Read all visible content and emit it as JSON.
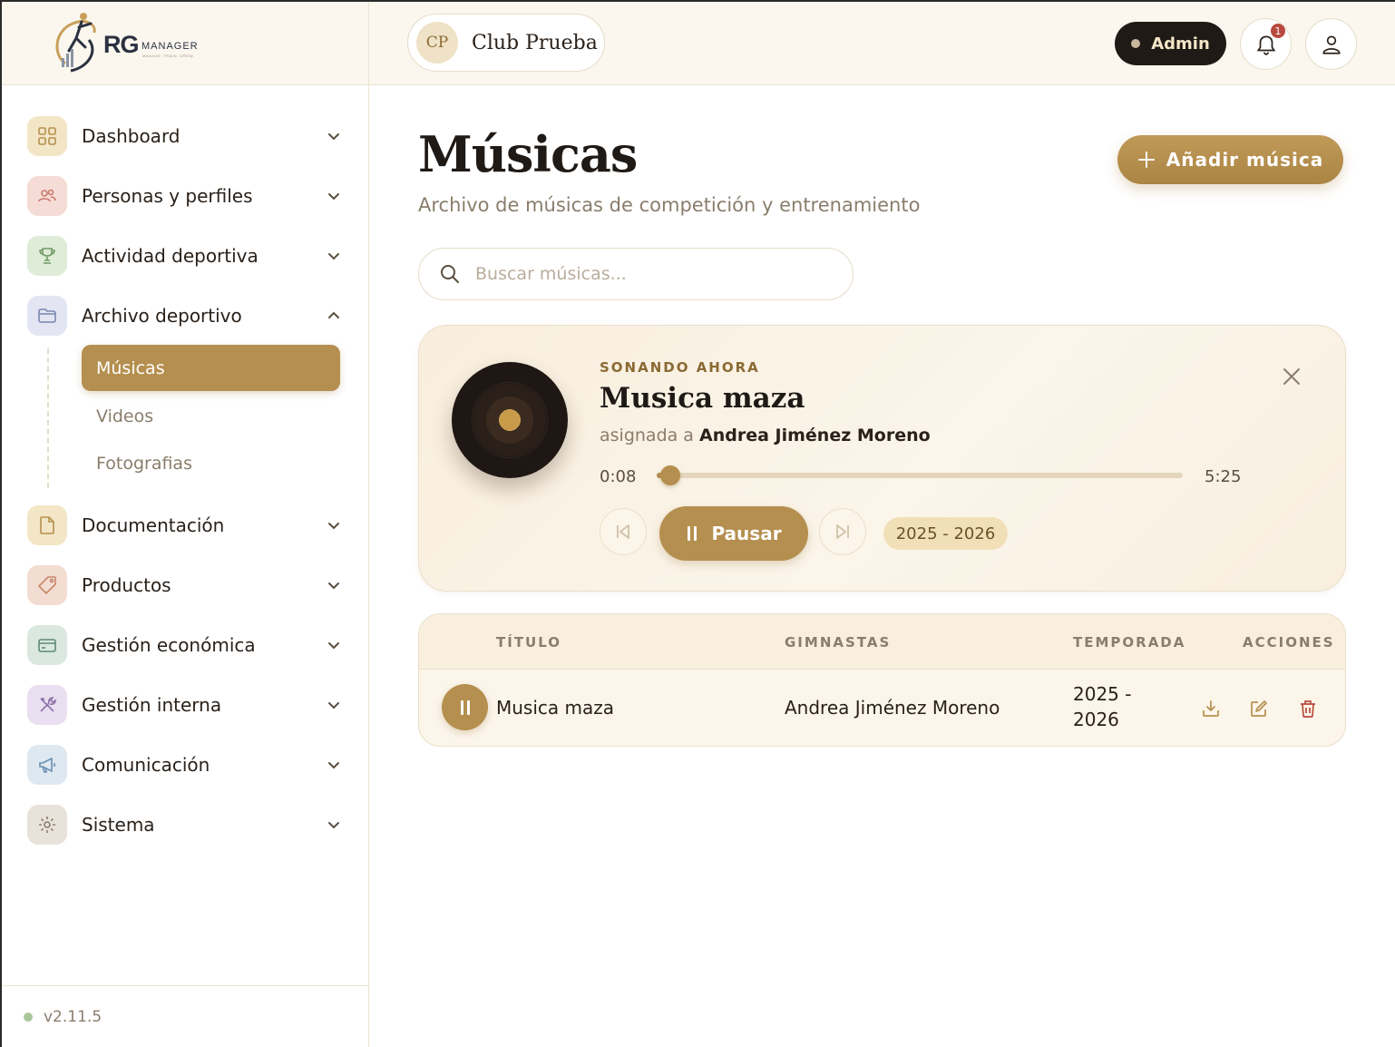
{
  "brand": {
    "logo_text": "RG",
    "logo_sub": "MANAGER",
    "logo_tagline": "MANAGE. TRAIN. GROW."
  },
  "sidebar": {
    "items": [
      {
        "label": "Dashboard",
        "icon": "grid-icon",
        "color": "#f3e6c6"
      },
      {
        "label": "Personas y perfiles",
        "icon": "users-icon",
        "color": "#f6dcd6"
      },
      {
        "label": "Actividad deportiva",
        "icon": "trophy-icon",
        "color": "#dfecd8"
      },
      {
        "label": "Archivo deportivo",
        "icon": "folder-icon",
        "color": "#e3e6f2",
        "expanded": true,
        "children": [
          {
            "label": "Músicas",
            "active": true
          },
          {
            "label": "Videos"
          },
          {
            "label": "Fotografias"
          }
        ]
      },
      {
        "label": "Documentación",
        "icon": "file-icon",
        "color": "#f3e6c6"
      },
      {
        "label": "Productos",
        "icon": "tag-icon",
        "color": "#f3ddd2"
      },
      {
        "label": "Gestión económica",
        "icon": "card-icon",
        "color": "#dae8e0"
      },
      {
        "label": "Gestión interna",
        "icon": "tools-icon",
        "color": "#eadff0"
      },
      {
        "label": "Comunicación",
        "icon": "megaphone-icon",
        "color": "#dde8f1"
      },
      {
        "label": "Sistema",
        "icon": "gear-icon",
        "color": "#e8e3da"
      }
    ],
    "version": "v2.11.5"
  },
  "header": {
    "club_initials": "CP",
    "club_name": "Club Prueba",
    "role": "Admin",
    "notifications": "1"
  },
  "page": {
    "title": "Músicas",
    "subtitle": "Archivo de músicas de competición y entrenamiento",
    "add_button": "Añadir música",
    "search_placeholder": "Buscar músicas..."
  },
  "player": {
    "now_playing_label": "SONANDO AHORA",
    "track_title": "Musica maza",
    "assigned_prefix": "asignada a",
    "assigned_to": "Andrea Jiménez Moreno",
    "current_time": "0:08",
    "total_time": "5:25",
    "progress": 0.025,
    "pause_label": "Pausar",
    "season": "2025 - 2026"
  },
  "table": {
    "columns": [
      "TÍTULO",
      "GIMNASTAS",
      "TEMPORADA",
      "ACCIONES"
    ],
    "rows": [
      {
        "title": "Musica maza",
        "gymnasts": "Andrea Jiménez Moreno",
        "season_line1": "2025 -",
        "season_line2": "2026",
        "playing": true
      }
    ]
  },
  "colors": {
    "accent": "#b58f4f",
    "dark": "#1f1a16",
    "danger": "#b84a3e",
    "cream": "#fbf7ef"
  }
}
